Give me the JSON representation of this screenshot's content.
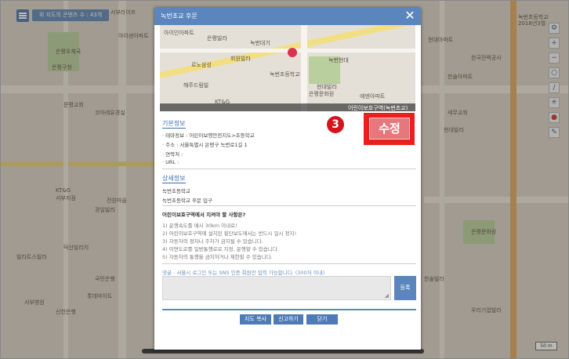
{
  "map": {
    "content_count": "위 지도의 콘텐츠 수 : 43개",
    "labels": [
      "서부라이프",
      "아이센아파트",
      "은평우체국",
      "은평구청",
      "문평교회",
      "코아레유경실",
      "KT&G",
      "서부지점",
      "전원마을",
      "경일빌라",
      "덕산빌리지",
      "빌라트스빌라",
      "국민은행",
      "롯데마이트",
      "서부병원",
      "신한은행",
      "현대아파트",
      "한국전력공사",
      "한솔아파트",
      "세무교회",
      "현대빌라",
      "은평문화원",
      "한솔빌라",
      "우리기업빌라",
      "녹번초등학교",
      "2018년3월"
    ],
    "scale_label": "50 m"
  },
  "tools": [
    {
      "name": "settings",
      "glyph": "⚙"
    },
    {
      "name": "zoom-in",
      "glyph": "+"
    },
    {
      "name": "zoom-out",
      "glyph": "−"
    },
    {
      "name": "circle",
      "glyph": "○"
    },
    {
      "name": "line",
      "glyph": "∕"
    },
    {
      "name": "sun",
      "glyph": "✳"
    },
    {
      "name": "marker",
      "glyph": "●"
    },
    {
      "name": "pen",
      "glyph": "✎"
    }
  ],
  "modal": {
    "title": "녹번초교 후문",
    "close": "✕",
    "thumb_labels": [
      "아이인아파트",
      "은평빌라",
      "녹번대기",
      "회원빌라",
      "르노삼성",
      "녹번초등학교",
      "녹번현대",
      "해주드림빌",
      "KT&G",
      "현대빌라",
      "은평문화원",
      "에덴아파트"
    ],
    "thumb_caption": "어린이보호구역(녹번초교)",
    "basic_title": "기본정보",
    "basic_lines": [
      "· 테마정보 : 어린이보행안전지도>초등학교",
      "· 주소 : 서울특별시 은평구 녹번로1길 1",
      "· 연락처 :",
      "· URL :"
    ],
    "detail_title": "상세정보",
    "detail_name": "녹번초등학교",
    "detail_desc": "녹번초등학교 후문 입구",
    "question": "어린이보호구역에서 지켜야 할 사항은?",
    "rules": [
      "1) 운행속도를 매시 30km 이내로!",
      "2) 어린이보호구역에 설치된 횡단보도에서는 반드시 일시 정지!",
      "3) 자동차의 정차나 주차가 금지될 수 있습니다.",
      "4) 이면도로를 일방통행로로 지정, 운행할 수 있습니다.",
      "5) 자동차의 통행을 금지하거나 제한할 수 있습니다."
    ],
    "comment_note": "댓글 - 서울시 로그인 또는 SNS 인증 회원만 입력 가능합니다. (300자 이내)",
    "register": "등록",
    "buttons": [
      "지도 복사",
      "신고하기",
      "닫기"
    ]
  },
  "edit_button": "수정",
  "step_badge": "3",
  "colors": {
    "accent": "#5b86bd",
    "highlight": "#e8211f",
    "edit": "#e6787b"
  }
}
